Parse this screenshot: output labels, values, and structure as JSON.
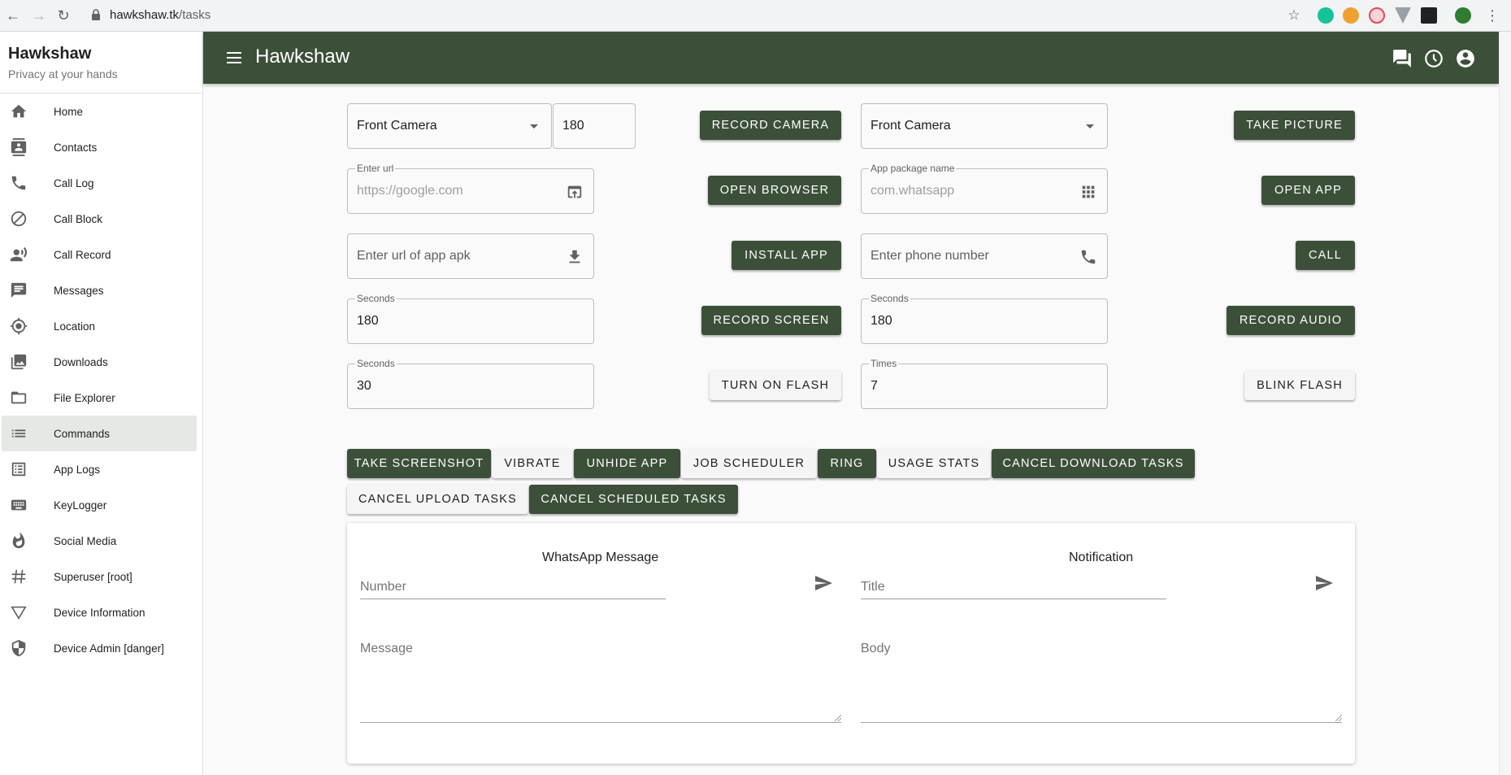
{
  "browser": {
    "url_host": "hawkshaw.tk",
    "url_path": "/tasks"
  },
  "sidebar": {
    "title": "Hawkshaw",
    "subtitle": "Privacy at your hands",
    "items": [
      {
        "label": "Home",
        "icon": "home-icon"
      },
      {
        "label": "Contacts",
        "icon": "contacts-icon"
      },
      {
        "label": "Call Log",
        "icon": "phone-icon"
      },
      {
        "label": "Call Block",
        "icon": "block-icon"
      },
      {
        "label": "Call Record",
        "icon": "record-voice-icon"
      },
      {
        "label": "Messages",
        "icon": "message-icon"
      },
      {
        "label": "Location",
        "icon": "location-icon"
      },
      {
        "label": "Downloads",
        "icon": "photo-library-icon"
      },
      {
        "label": "File Explorer",
        "icon": "folder-icon"
      },
      {
        "label": "Commands",
        "icon": "list-icon",
        "active": true
      },
      {
        "label": "App Logs",
        "icon": "list-alt-icon"
      },
      {
        "label": "KeyLogger",
        "icon": "keyboard-icon"
      },
      {
        "label": "Social Media",
        "icon": "whatshot-icon"
      },
      {
        "label": "Superuser [root]",
        "icon": "hash-icon"
      },
      {
        "label": "Device Information",
        "icon": "triangle-icon"
      },
      {
        "label": "Device Admin [danger]",
        "icon": "shield-icon"
      }
    ]
  },
  "appbar": {
    "title": "Hawkshaw",
    "color": "#3c5039"
  },
  "commands": {
    "camera1_select": "Front Camera",
    "camera1_seconds": "180",
    "record_camera": "RECORD CAMERA",
    "camera2_select": "Front Camera",
    "take_picture": "TAKE PICTURE",
    "url_label": "Enter url",
    "url_placeholder": "https://google.com",
    "open_browser": "OPEN BROWSER",
    "package_label": "App package name",
    "package_placeholder": "com.whatsapp",
    "open_app": "OPEN APP",
    "apk_placeholder": "Enter url of app apk",
    "install_app": "INSTALL APP",
    "phone_placeholder": "Enter phone number",
    "call": "CALL",
    "screen_label": "Seconds",
    "screen_seconds": "180",
    "record_screen": "RECORD SCREEN",
    "audio_label": "Seconds",
    "audio_seconds": "180",
    "record_audio": "RECORD AUDIO",
    "flash_label": "Seconds",
    "flash_seconds": "30",
    "turn_on_flash": "TURN ON FLASH",
    "blink_label": "Times",
    "blink_times": "7",
    "blink_flash": "BLINK FLASH"
  },
  "actions": [
    {
      "label": "TAKE SCREENSHOT",
      "style": "dark"
    },
    {
      "label": "VIBRATE",
      "style": "light"
    },
    {
      "label": "UNHIDE APP",
      "style": "dark"
    },
    {
      "label": "JOB SCHEDULER",
      "style": "light"
    },
    {
      "label": "RING",
      "style": "dark"
    },
    {
      "label": "USAGE STATS",
      "style": "light"
    },
    {
      "label": "CANCEL DOWNLOAD TASKS",
      "style": "dark"
    },
    {
      "label": "CANCEL UPLOAD TASKS",
      "style": "light"
    },
    {
      "label": "CANCEL SCHEDULED TASKS",
      "style": "dark"
    }
  ],
  "whatsapp": {
    "title": "WhatsApp Message",
    "number_placeholder": "Number",
    "message_placeholder": "Message"
  },
  "notification": {
    "title": "Notification",
    "title_placeholder": "Title",
    "body_placeholder": "Body"
  }
}
